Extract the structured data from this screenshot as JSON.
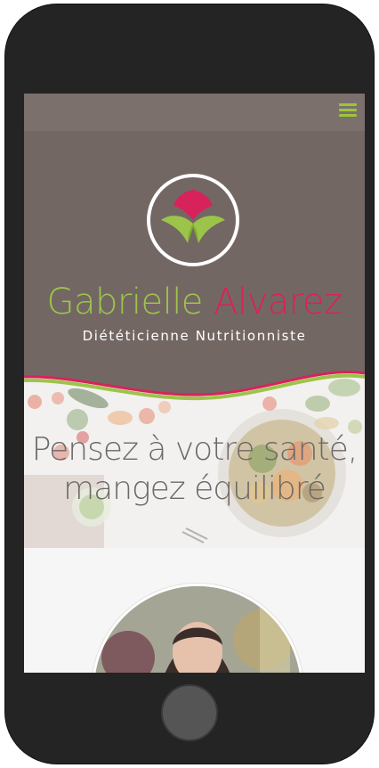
{
  "header": {
    "menu_icon": "hamburger-menu-icon",
    "logo_icon": "lotus-leaf-logo-icon",
    "brand_first_name": "Gabrielle",
    "brand_last_name": "Alvarez",
    "subtitle": "Diététicienne Nutritionniste"
  },
  "hero": {
    "line1": "Pensez à votre santé,",
    "line2": "mangez équilibré"
  },
  "colors": {
    "accent_green": "#9dc44a",
    "accent_pink": "#d8225b",
    "header_brown": "#736764",
    "topbar_brown": "#7c706c"
  }
}
